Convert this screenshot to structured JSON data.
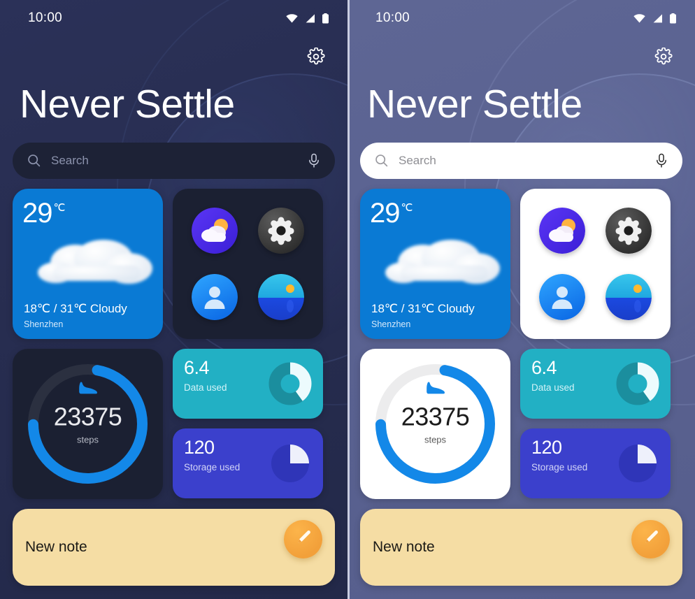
{
  "panels": [
    {
      "theme": "dark",
      "status": {
        "time": "10:00",
        "wifi_icon": "wifi-icon",
        "signal_icon": "cellular-signal-icon",
        "battery_icon": "battery-icon"
      },
      "header": {
        "settings_icon": "gear-icon",
        "title": "Never Settle"
      },
      "search": {
        "icon": "search-icon",
        "placeholder": "Search",
        "value": "",
        "mic_icon": "microphone-icon"
      },
      "weather": {
        "temperature": "29",
        "unit": "℃",
        "range": "18℃ / 31℃  Cloudy",
        "low": "18℃",
        "high": "31℃",
        "condition": "Cloudy",
        "city": "Shenzhen",
        "art_icon": "cloud-icon",
        "bg_color": "#0a7ad4"
      },
      "app_icons": [
        {
          "name": "weather-app-icon",
          "label": "Weather"
        },
        {
          "name": "settings-app-icon",
          "label": "Settings"
        },
        {
          "name": "contacts-app-icon",
          "label": "Contacts"
        },
        {
          "name": "gallery-app-icon",
          "label": "Gallery"
        }
      ],
      "steps": {
        "value": "23375",
        "label": "steps",
        "icon": "shoe-icon",
        "progress_percent": 72,
        "track_color": "#2b3040",
        "arc_color": "#1388e8"
      },
      "stats": [
        {
          "name": "data-used",
          "value": "6.4",
          "label": "Data used",
          "percent": 40,
          "bg_color": "#22b0c4",
          "chart": "donut"
        },
        {
          "name": "storage-used",
          "value": "120",
          "label": "Storage used",
          "percent": 25,
          "bg_color": "#3b40cc",
          "chart": "pie"
        }
      ],
      "note": {
        "title": "New note",
        "fab_icon": "pencil-icon",
        "bg_color": "#f5dda4"
      }
    },
    {
      "theme": "light",
      "status": {
        "time": "10:00",
        "wifi_icon": "wifi-icon",
        "signal_icon": "cellular-signal-icon",
        "battery_icon": "battery-icon"
      },
      "header": {
        "settings_icon": "gear-icon",
        "title": "Never Settle"
      },
      "search": {
        "icon": "search-icon",
        "placeholder": "Search",
        "value": "",
        "mic_icon": "microphone-icon"
      },
      "weather": {
        "temperature": "29",
        "unit": "℃",
        "range": "18℃ / 31℃  Cloudy",
        "low": "18℃",
        "high": "31℃",
        "condition": "Cloudy",
        "city": "Shenzhen",
        "art_icon": "cloud-icon",
        "bg_color": "#0a7ad4"
      },
      "app_icons": [
        {
          "name": "weather-app-icon",
          "label": "Weather"
        },
        {
          "name": "settings-app-icon",
          "label": "Settings"
        },
        {
          "name": "contacts-app-icon",
          "label": "Contacts"
        },
        {
          "name": "gallery-app-icon",
          "label": "Gallery"
        }
      ],
      "steps": {
        "value": "23375",
        "label": "steps",
        "icon": "shoe-icon",
        "progress_percent": 72,
        "track_color": "#ececed",
        "arc_color": "#1388e8"
      },
      "stats": [
        {
          "name": "data-used",
          "value": "6.4",
          "label": "Data used",
          "percent": 40,
          "bg_color": "#22b0c4",
          "chart": "donut"
        },
        {
          "name": "storage-used",
          "value": "120",
          "label": "Storage used",
          "percent": 25,
          "bg_color": "#3b40cc",
          "chart": "pie"
        }
      ],
      "note": {
        "title": "New note",
        "fab_icon": "pencil-icon",
        "bg_color": "#f5dda4"
      }
    }
  ]
}
